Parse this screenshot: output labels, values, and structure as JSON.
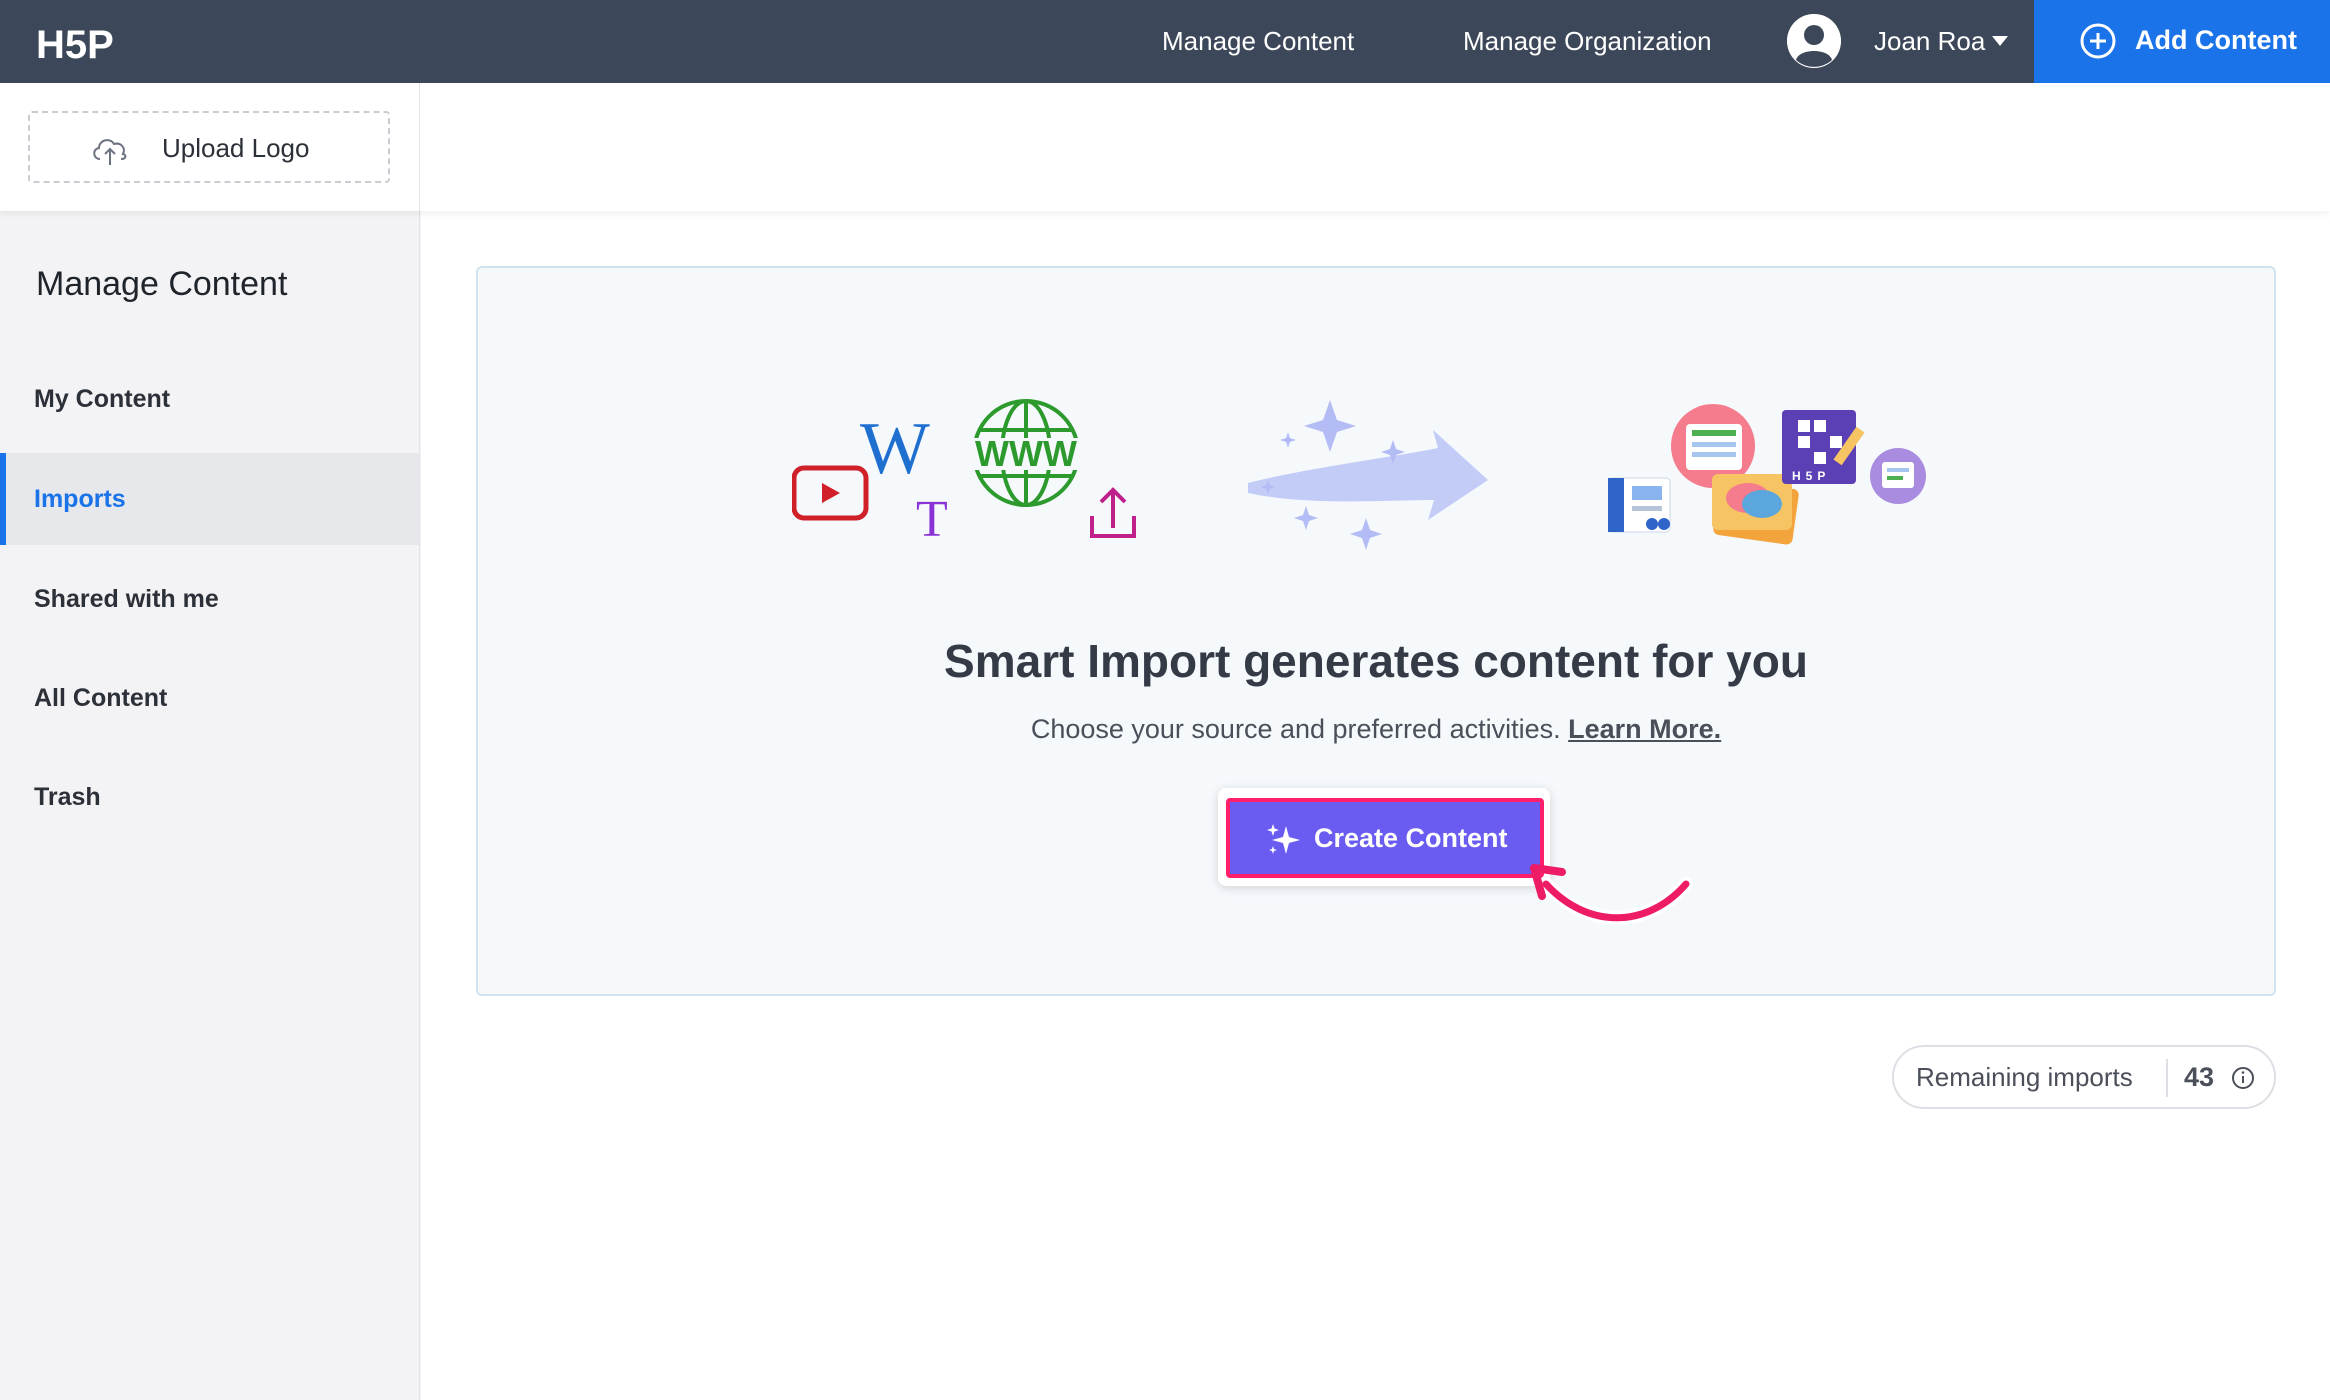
{
  "topbar": {
    "logo_text": "H5P",
    "nav": [
      {
        "label": "Manage Content"
      },
      {
        "label": "Manage Organization"
      }
    ],
    "user_name": "Joan Roa",
    "add_content_label": "Add Content"
  },
  "header": {
    "upload_logo_label": "Upload Logo"
  },
  "sidebar": {
    "title": "Manage Content",
    "items": [
      {
        "label": "My Content",
        "active": false
      },
      {
        "label": "Imports",
        "active": true
      },
      {
        "label": "Shared with me",
        "active": false
      },
      {
        "label": "All Content",
        "active": false
      },
      {
        "label": "Trash",
        "active": false
      }
    ]
  },
  "main": {
    "title": "Smart Import generates content for you",
    "subtitle": "Choose your source and preferred activities.",
    "learn_more": "Learn More.",
    "create_button_label": "Create Content",
    "illustration": {
      "wiki_letter": "W",
      "text_letter": "T",
      "web_label": "WWW",
      "grid_letters": "H5P"
    },
    "remaining_label": "Remaining imports",
    "remaining_count": "43"
  },
  "colors": {
    "topbar": "#3c4859",
    "accent": "#1a73e8",
    "create_button": "#6a5cf0",
    "highlight": "#ff1f6a"
  },
  "icons": [
    "user-avatar-icon",
    "caret-down-icon",
    "plus-circle-icon",
    "cloud-upload-icon",
    "youtube-icon",
    "wikipedia-icon",
    "text-icon",
    "globe-icon",
    "upload-icon",
    "sparkle-icon",
    "info-icon",
    "curved-arrow-icon"
  ]
}
